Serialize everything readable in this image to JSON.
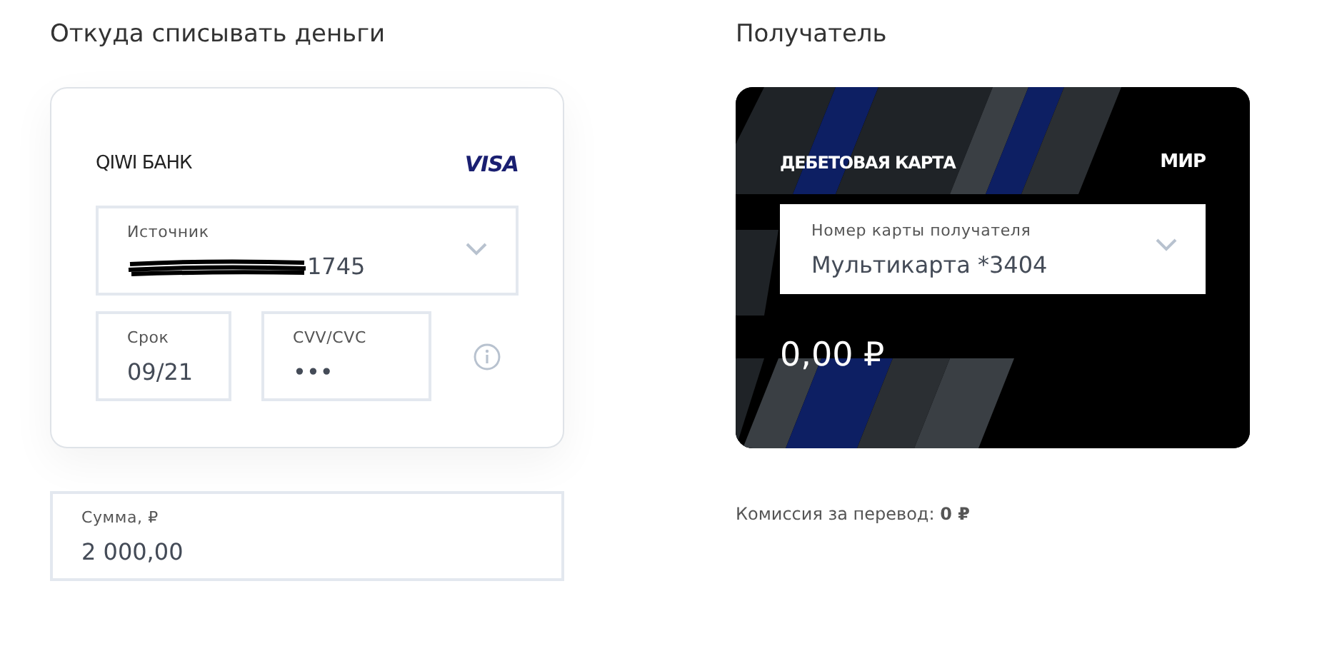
{
  "source": {
    "title": "Откуда списывать деньги",
    "card": {
      "bank": "QIWI БАНК",
      "network": "VISA",
      "source_field": {
        "label": "Источник",
        "value": "1745",
        "redacted": true
      },
      "expiry_field": {
        "label": "Срок",
        "value": "09/21"
      },
      "cvv_field": {
        "label": "CVV/CVC",
        "value": "•••"
      }
    },
    "amount_field": {
      "label": "Сумма, ₽",
      "value": "2 000,00"
    }
  },
  "recipient": {
    "title": "Получатель",
    "card": {
      "kind": "picture",
      "type_label": "ДЕБЕТОВАЯ КАРТА",
      "network": "МИР",
      "number_field": {
        "label": "Номер карты получателя",
        "value": "Мультикарта *3404"
      },
      "balance": "0,00 ₽"
    },
    "commission": "Комиссия за перевод: **0 ₽**"
  }
}
